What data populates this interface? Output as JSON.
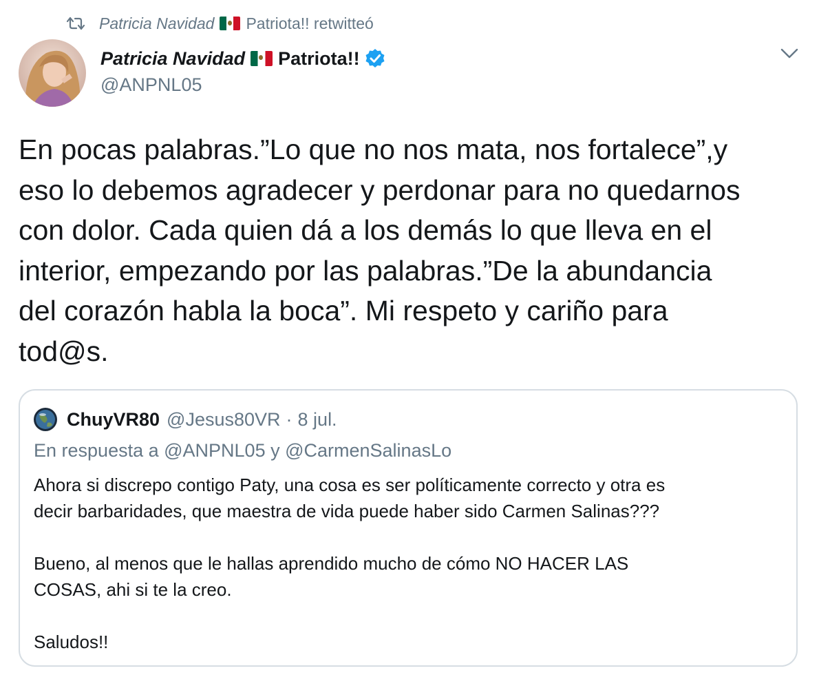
{
  "retweet": {
    "icon": "retweet-icon",
    "name": "Patricia Navidad",
    "flag": "mexico-flag-icon",
    "suffix": "Patriota!! retwitteó"
  },
  "author": {
    "name_italic": "Patricia Navidad",
    "flag": "mexico-flag-icon",
    "name_suffix": "Patriota!!",
    "verified_icon": "verified-badge-icon",
    "handle": "@ANPNL05"
  },
  "menu_icon": "chevron-down-icon",
  "tweet_text": "En pocas palabras.”Lo que no nos mata, nos fortalece”,y\neso lo debemos agradecer y perdonar para no quedarnos\ncon dolor. Cada quien dá a los demás lo que lleva en el\ninterior, empezando por las palabras.”De la abundancia\ndel corazón habla la boca”. Mi respeto y cariño para\ntod@s.",
  "quote": {
    "avatar_icon": "globe-avatar",
    "name": "ChuyVR80",
    "handle": "@Jesus80VR",
    "separator": "·",
    "date": "8 jul.",
    "reply_to": "En respuesta a @ANPNL05 y @CarmenSalinasLo",
    "text": "Ahora si discrepo contigo Paty, una cosa es ser políticamente correcto y otra es\ndecir barbaridades, que maestra de vida puede haber sido Carmen Salinas???\n\nBueno, al menos que le hallas aprendido mucho de cómo NO HACER LAS\nCOSAS, ahi si te la creo.\n\nSaludos!!"
  },
  "colors": {
    "text": "#14171a",
    "secondary": "#657786",
    "verified": "#1da1f2",
    "border": "#d6dde3"
  }
}
